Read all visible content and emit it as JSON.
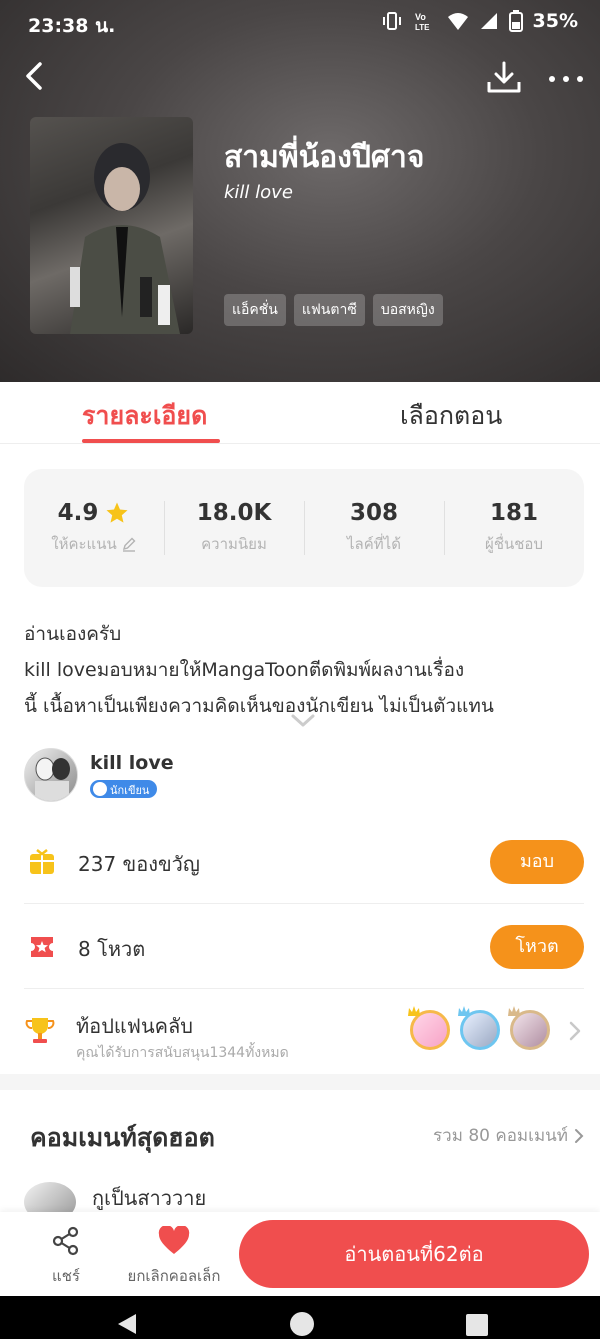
{
  "status_bar": {
    "time": "23:38 น.",
    "network": "LTE",
    "battery": "35%"
  },
  "book": {
    "title": "สามพี่น้องปีศาจ",
    "author": "kill love",
    "tags": [
      "แอ็คชั่น",
      "แฟนตาซี",
      "บอสหญิง"
    ]
  },
  "tabs": {
    "detail": "รายละเอียด",
    "episodes": "เลือกตอน"
  },
  "stats": [
    {
      "value": "4.9",
      "label": "ให้คะแนน"
    },
    {
      "value": "18.0K",
      "label": "ความนิยม"
    },
    {
      "value": "308",
      "label": "ไลค์ที่ได้"
    },
    {
      "value": "181",
      "label": "ผู้ชื่นชอบ"
    }
  ],
  "description": {
    "line1": "อ่านเองครับ",
    "line2": "kill loveมอบหมายให้MangaToonตีดพิมพ์ผลงานเรื่อง",
    "line3": "นี้ เนื้อหาเป็นเพียงความคิดเห็นของนักเขียน ไม่เป็นตัวแทน"
  },
  "author_card": {
    "name": "kill love",
    "badge": "นักเขียน"
  },
  "gifts": {
    "label": "237 ของขวัญ",
    "button": "มอบ"
  },
  "votes": {
    "label": "8 โหวต",
    "button": "โหวต"
  },
  "fanclub": {
    "title": "ท้อปแฟนคลับ",
    "subtitle": "คุณได้รับการสนับสนุน1344ทั้งหมด"
  },
  "comments": {
    "title": "คอมเมนท์สุดฮอต",
    "total": "รวม 80 คอมเมนท์",
    "first_user": "กูเป็นสาววาย"
  },
  "bottom_bar": {
    "share": "แชร์",
    "favorite": "ยกเลิกคอลเล็ก",
    "read": "อ่านตอนที่62ต่อ"
  },
  "colors": {
    "accent_red": "#f04e4e",
    "accent_orange": "#f5921b",
    "star_yellow": "#f7c31a"
  }
}
